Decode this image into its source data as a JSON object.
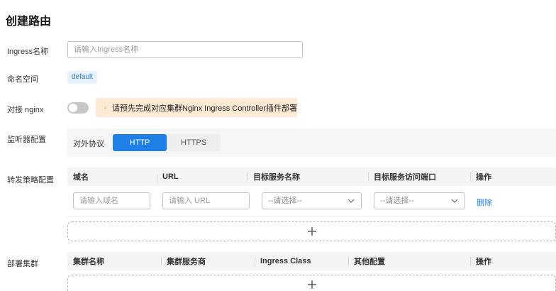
{
  "page": {
    "title": "创建路由"
  },
  "form": {
    "ingress_name": {
      "label": "Ingress名称",
      "placeholder": "请输入Ingress名称",
      "value": ""
    },
    "namespace": {
      "label": "命名空间",
      "tag": "default"
    },
    "nginx": {
      "label": "对接 nginx",
      "enabled": false,
      "warning": "请预先完成对应集群Nginx Ingress Controller插件部署"
    },
    "listener": {
      "label": "监听器配置",
      "protocol_label": "对外协议",
      "protocols": [
        "HTTP",
        "HTTPS"
      ],
      "selected": "HTTP"
    },
    "forwarding": {
      "label": "转发策略配置",
      "columns": [
        "域名",
        "URL",
        "目标服务名称",
        "目标服务访问端口",
        "操作"
      ],
      "row": {
        "domain_placeholder": "请输入域名",
        "url_placeholder": "请输入 URL",
        "service_select": "--请选择--",
        "port_select": "--请选择--",
        "action": "删除"
      }
    },
    "clusters": {
      "label": "部署集群",
      "columns": [
        "集群名称",
        "集群服务商",
        "Ingress Class",
        "其他配置",
        "操作"
      ]
    }
  },
  "colors": {
    "accent": "#1e7fe6",
    "warning_bg": "#fde9d4",
    "warning_icon": "#f5a623"
  }
}
